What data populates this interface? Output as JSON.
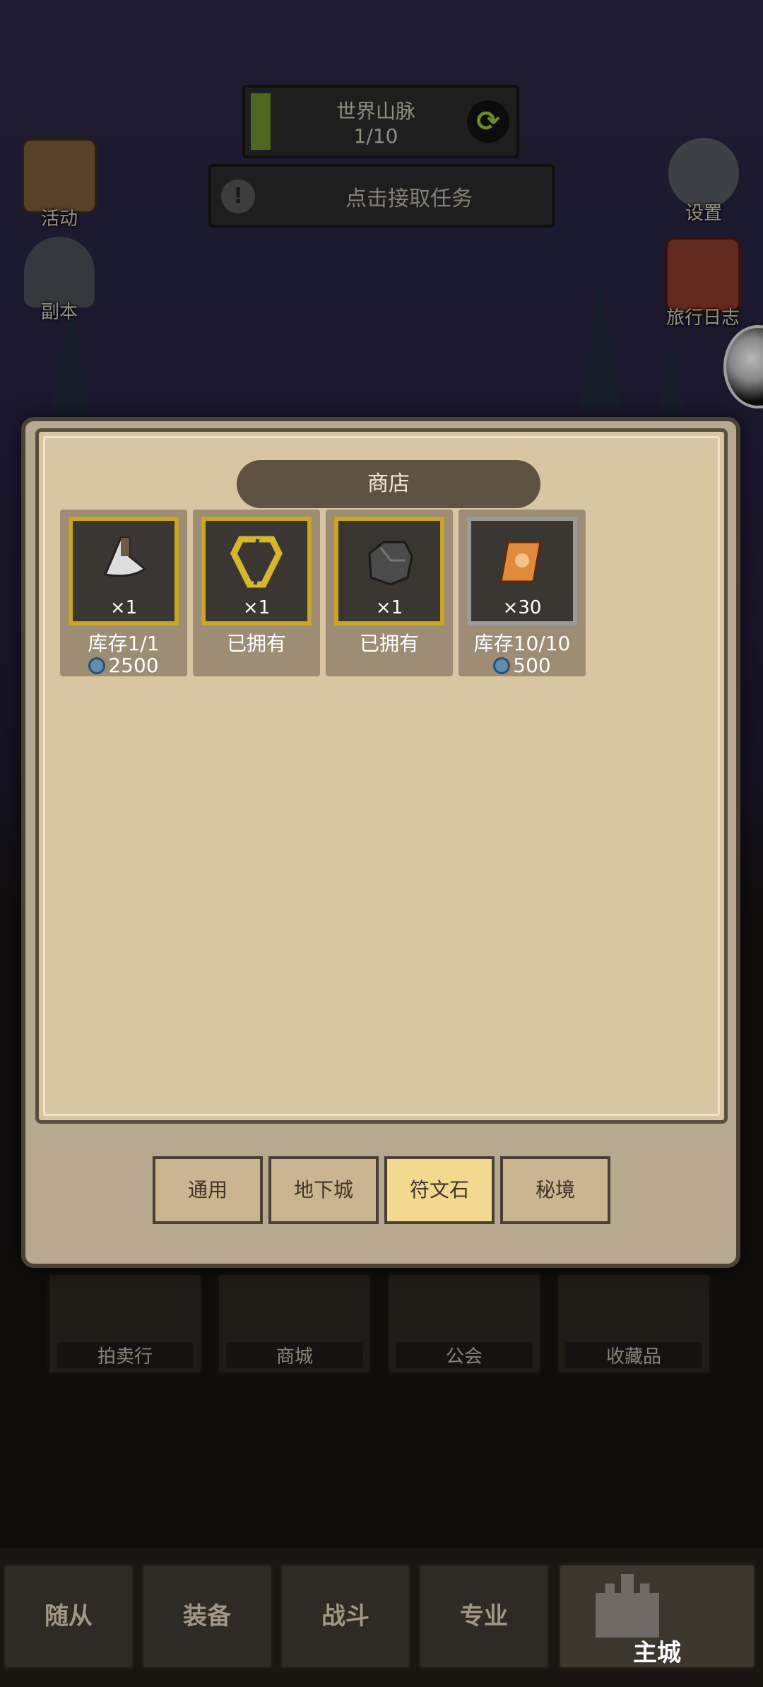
{
  "hud": {
    "region_name": "世界山脉",
    "region_progress": "1/10",
    "quest_prompt": "点击接取任务"
  },
  "side_buttons": {
    "activity": "活动",
    "dungeon": "副本",
    "settings": "设置",
    "travel_log": "旅行日志"
  },
  "shop": {
    "title": "商店",
    "items": [
      {
        "icon": "horn-icon",
        "qty": "×1",
        "status": "库存1/1",
        "price": "2500"
      },
      {
        "icon": "broken-ring-icon",
        "qty": "×1",
        "status": "已拥有"
      },
      {
        "icon": "rock-icon",
        "qty": "×1",
        "status": "已拥有"
      },
      {
        "icon": "scroll-icon",
        "qty": "×30",
        "status": "库存10/10",
        "price": "500"
      }
    ],
    "tabs": [
      "通用",
      "地下城",
      "符文石",
      "秘境"
    ],
    "active_tab": "符文石"
  },
  "features": [
    "拍卖行",
    "商城",
    "公会",
    "收藏品"
  ],
  "nav": {
    "items": [
      "随从",
      "装备",
      "战斗",
      "专业",
      "主城"
    ],
    "active": "主城"
  },
  "colors": {
    "gold_frame": "#c7a526",
    "silver_frame": "#9a9a9a",
    "paper": "#d8c5a2",
    "active_tab": "#f2d98f"
  }
}
